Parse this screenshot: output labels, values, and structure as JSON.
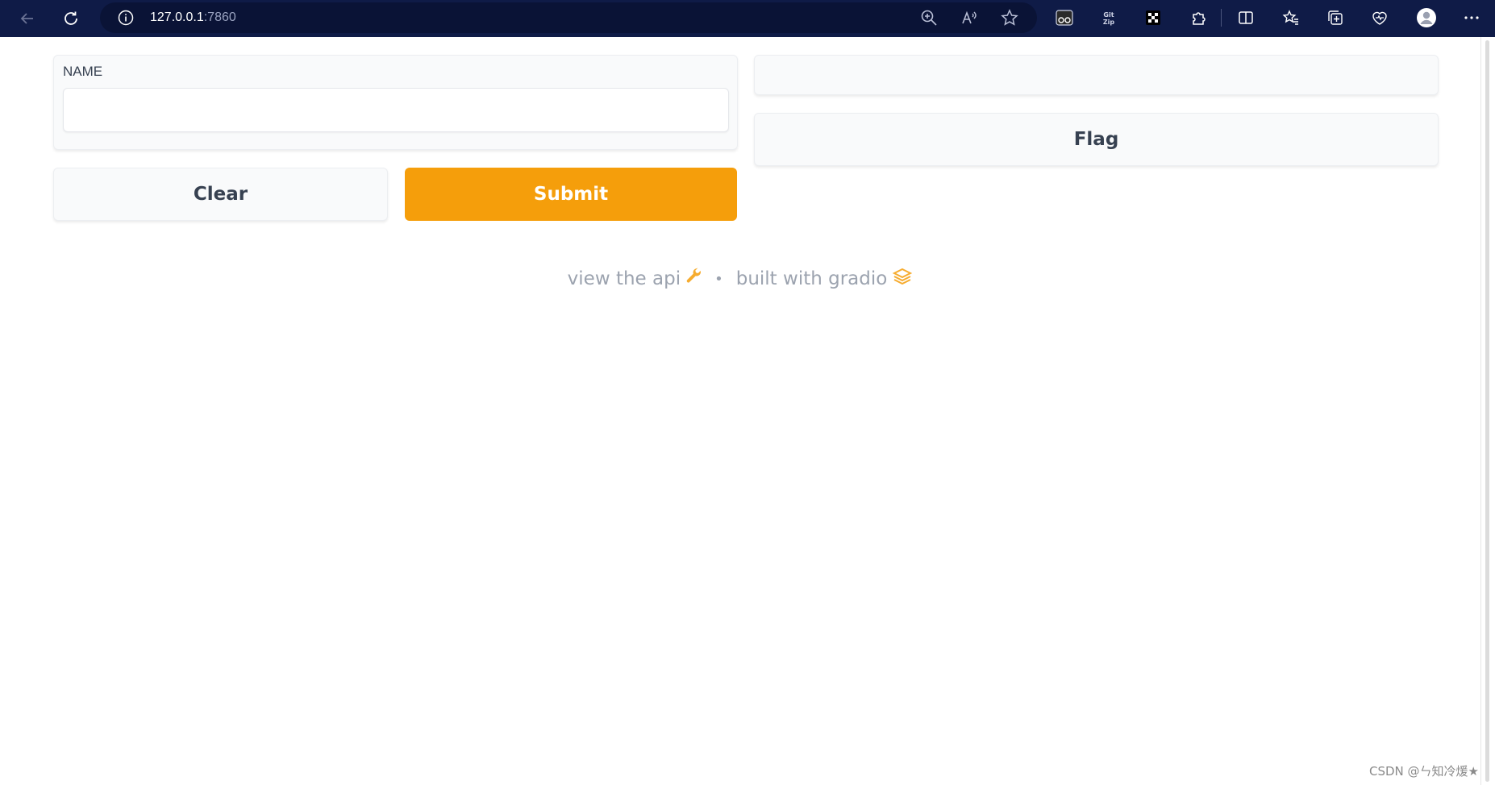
{
  "browser": {
    "url_host": "127.0.0.1",
    "url_port": ":7860"
  },
  "form": {
    "name_label": "NAME",
    "name_value": "",
    "clear_label": "Clear",
    "submit_label": "Submit",
    "flag_label": "Flag",
    "output_value": ""
  },
  "footer": {
    "api_text": "view the api",
    "separator": "•",
    "built_text": "built with gradio"
  },
  "watermark": "CSDN @ㄣ知冷煖★",
  "colors": {
    "accent": "#f59e0b",
    "chrome": "#0f1b47"
  }
}
